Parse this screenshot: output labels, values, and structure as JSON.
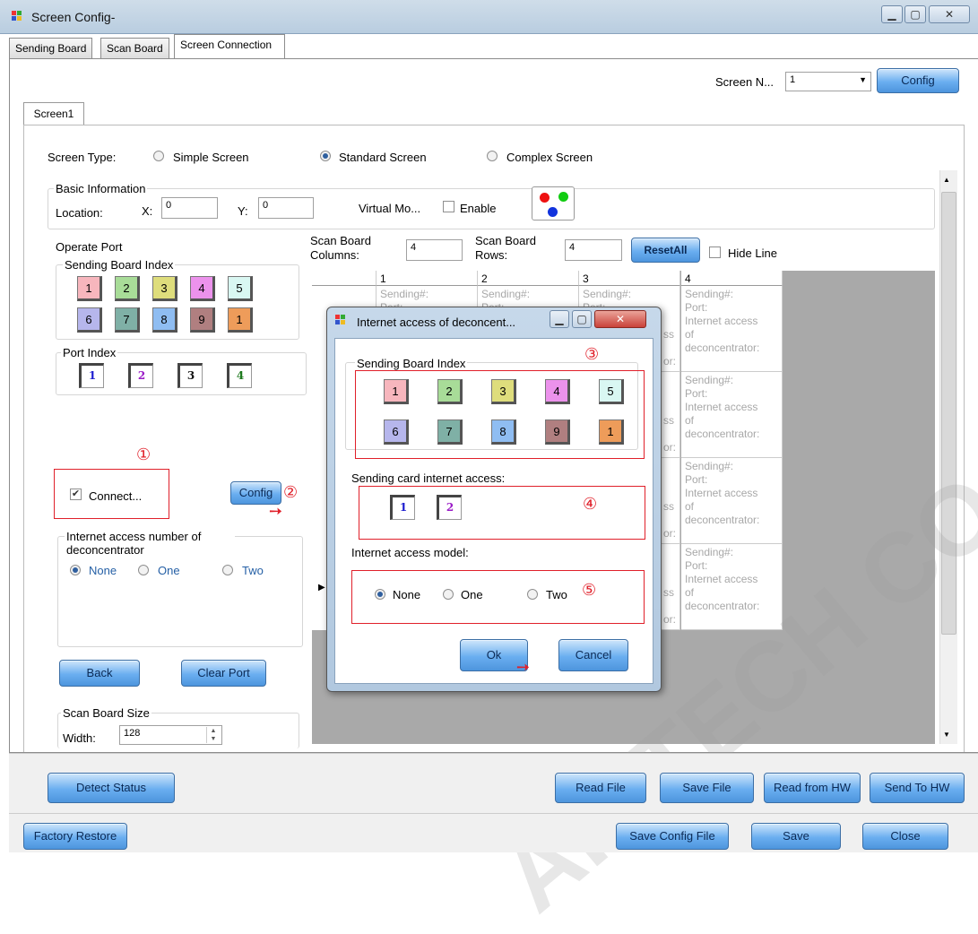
{
  "window": {
    "title": "Screen Config-"
  },
  "tabs": [
    "Sending Board",
    "Scan Board",
    "Screen Connection"
  ],
  "screen_number": {
    "label": "Screen N...",
    "value": "1",
    "config_label": "Config"
  },
  "subtab": "Screen1",
  "screen_type": {
    "label": "Screen Type:",
    "options": [
      "Simple Screen",
      "Standard Screen",
      "Complex Screen"
    ],
    "selected": "Standard Screen"
  },
  "basic_info": {
    "title": "Basic Information",
    "location_label": "Location:",
    "x_label": "X:",
    "x_value": "0",
    "y_label": "Y:",
    "y_value": "0",
    "virtual_label": "Virtual Mo...",
    "enable_label": "Enable"
  },
  "operate_port": {
    "title": "Operate Port",
    "sending_index_title": "Sending Board Index",
    "tiles": [
      {
        "label": "1",
        "color": "#f7b6bd"
      },
      {
        "label": "2",
        "color": "#a8dc98"
      },
      {
        "label": "3",
        "color": "#dedd7c"
      },
      {
        "label": "4",
        "color": "#ec92ec"
      },
      {
        "label": "5",
        "color": "#d9f7f2"
      },
      {
        "label": "6",
        "color": "#b6b6ec"
      },
      {
        "label": "7",
        "color": "#7fb0a6"
      },
      {
        "label": "8",
        "color": "#8fbdf2"
      },
      {
        "label": "9",
        "color": "#b07f80"
      },
      {
        "label": "1",
        "color": "#ee9c5a"
      }
    ],
    "port_index_title": "Port Index",
    "ports": [
      {
        "label": "1",
        "color": "#1b1bcf"
      },
      {
        "label": "2",
        "color": "#9a1bc7"
      },
      {
        "label": "3",
        "color": "#111111"
      },
      {
        "label": "4",
        "color": "#1f7a1f"
      }
    ]
  },
  "connect": {
    "label": "Connect...",
    "checked": "✔",
    "config_label": "Config"
  },
  "deconcentrator": {
    "title": "Internet access number of deconcentrator",
    "options": [
      "None",
      "One",
      "Two"
    ]
  },
  "buttons": {
    "back": "Back",
    "clear_port": "Clear Port",
    "reset_all": "ResetAll",
    "hide_line": "Hide Line"
  },
  "scan_size": {
    "title": "Scan Board Size",
    "width_label": "Width:",
    "width_value": "128"
  },
  "scan_grid": {
    "columns_label": "Scan Board Columns:",
    "columns_value": "4",
    "rows_label": "Scan Board Rows:",
    "rows_value": "4",
    "headers": [
      "1",
      "2",
      "3",
      "4"
    ]
  },
  "cell": {
    "sending": "Sending#:",
    "port": "Port:",
    "access": "Internet access",
    "of": "of",
    "deconcentrator": "deconcentrator:",
    "frag1": "ss",
    "frag2": "or:"
  },
  "dialog": {
    "title": "Internet access of deconcent...",
    "sending_index_title": "Sending Board Index",
    "sending_card_title": "Sending card internet access:",
    "model_title": "Internet access model:",
    "model_options": [
      "None",
      "One",
      "Two"
    ],
    "ok": "Ok",
    "cancel": "Cancel"
  },
  "annotations": [
    "①",
    "②",
    "③",
    "④",
    "⑤"
  ],
  "bottom": {
    "detect_status": "Detect Status",
    "read_file": "Read File",
    "save_file": "Save File",
    "read_hw": "Read from HW",
    "send_hw": "Send To HW",
    "factory_restore": "Factory Restore",
    "save_config": "Save Config File",
    "save": "Save",
    "close": "Close"
  },
  "watermark": "AR TECH CO., LT"
}
